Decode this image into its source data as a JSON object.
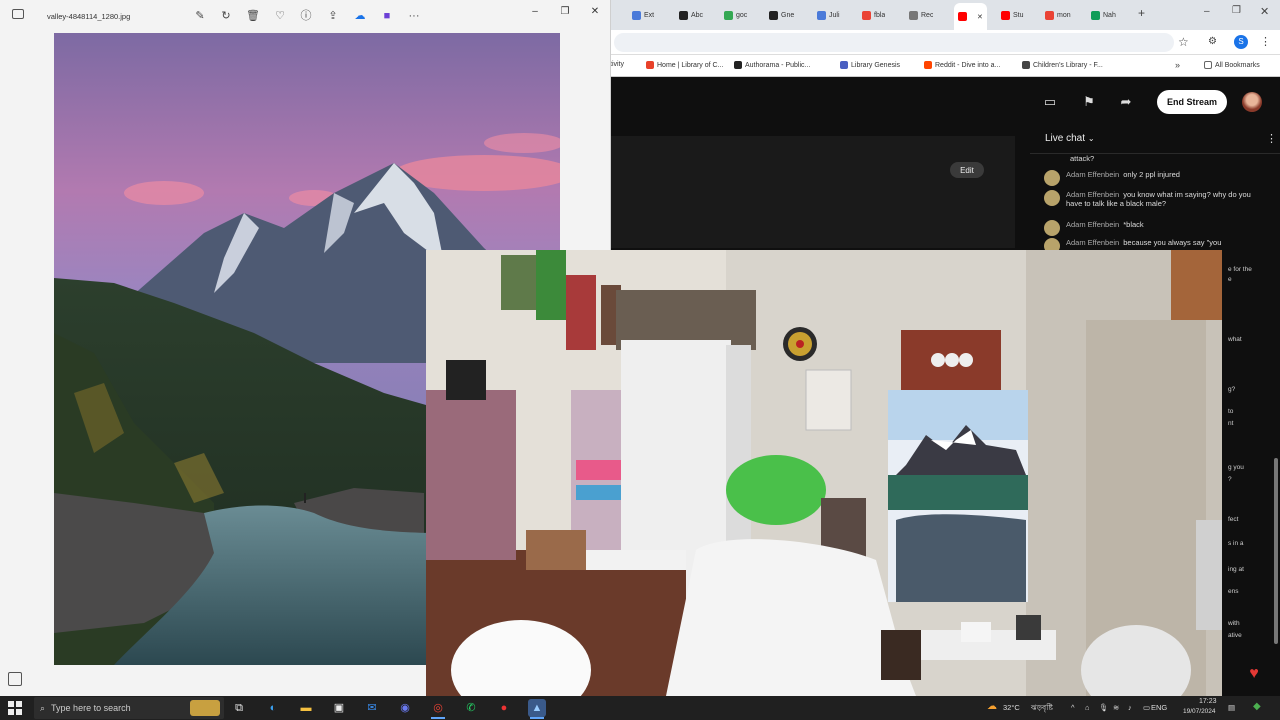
{
  "browser": {
    "tabs": [
      {
        "label": "Ext",
        "color": "#4a7ad9"
      },
      {
        "label": "Abc",
        "color": "#222222"
      },
      {
        "label": "goc",
        "color": "#34a853"
      },
      {
        "label": "Gne",
        "color": "#222222"
      },
      {
        "label": "Juli",
        "color": "#4a7ad9"
      },
      {
        "label": "fbla",
        "color": "#ea4335"
      },
      {
        "label": "Rec",
        "color": "#777777"
      },
      {
        "label": "",
        "color": "#ff0000"
      },
      {
        "label": "Stu",
        "color": "#ff0000"
      },
      {
        "label": "mon",
        "color": "#ea4335"
      },
      {
        "label": "Nah",
        "color": "#0f9d58"
      }
    ],
    "new_tab_glyph": "+",
    "bookmarks": [
      {
        "label": "tivity",
        "color": "#ffffff"
      },
      {
        "label": "Home | Library of C...",
        "color": "#e8412a"
      },
      {
        "label": "Authorama - Public...",
        "color": "#222222"
      },
      {
        "label": "Library Genesis",
        "color": "#4a5fc1"
      },
      {
        "label": "Reddit - Dive into a...",
        "color": "#ff4500"
      },
      {
        "label": "Children's Library - F...",
        "color": "#444444"
      }
    ],
    "all_bookmarks_label": "All Bookmarks"
  },
  "youtube": {
    "end_stream_label": "End Stream",
    "edit_label": "Edit",
    "chat_title": "Live chat",
    "chat_messages": [
      {
        "author": "",
        "text": "attack?"
      },
      {
        "author": "Adam Effenbein",
        "text": "only 2 ppl injured"
      },
      {
        "author": "Adam Effenbein",
        "text": "you know what im saying? why do you have to talk like a black male?"
      },
      {
        "author": "Adam Effenbein",
        "text": "*black"
      },
      {
        "author": "Adam Effenbein",
        "text": "because you always say \"you"
      }
    ],
    "right_snippets": [
      "e for the",
      "e",
      "what",
      "g?",
      "to",
      "nt",
      "g you",
      "?",
      "fect",
      "s in a",
      "ing at",
      "ens",
      "with",
      "ative"
    ]
  },
  "photos": {
    "filename": "valley-4848114_1280.jpg",
    "toolbar_icons": [
      "edit-icon",
      "rotate-icon",
      "delete-icon",
      "favorite-icon",
      "info-icon",
      "share-icon",
      "onedrive-icon",
      "clipchamp-icon",
      "more-icon"
    ],
    "more_glyph": "···"
  },
  "taskbar": {
    "search_placeholder": "Type here to search",
    "weather": "32°C",
    "weather_label": "ঝড়বৃষ্টি",
    "language": "ENG",
    "time": "17:23",
    "date": "19/07/2024"
  },
  "colors": {
    "yt_bg": "#0f0f0f",
    "taskbar_bg": "#202020",
    "chat_heart": "#e53935"
  }
}
